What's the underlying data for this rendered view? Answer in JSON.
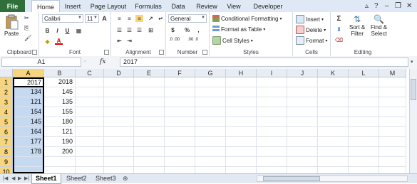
{
  "tabs": [
    "File",
    "Home",
    "Insert",
    "Page Layout",
    "Formulas",
    "Data",
    "Review",
    "View",
    "Developer"
  ],
  "ribbon": {
    "clipboard": {
      "paste": "Paste",
      "label": "Clipboard"
    },
    "font": {
      "name": "Calibri",
      "size": "11",
      "label": "Font",
      "bold": "B",
      "italic": "I",
      "underline": "U",
      "grow": "A",
      "shrink": "A",
      "fill_letter": "A"
    },
    "alignment": {
      "label": "Alignment"
    },
    "number": {
      "format": "General",
      "label": "Number",
      "currency": "$",
      "percent": "%",
      "comma": ",",
      "inc": ".0 .00",
      "dec": ".00 .0"
    },
    "styles": {
      "conditional": "Conditional Formatting",
      "format_table": "Format as Table",
      "cell_styles": "Cell Styles",
      "label": "Styles"
    },
    "cells": {
      "insert": "Insert",
      "delete": "Delete",
      "format": "Format",
      "label": "Cells"
    },
    "editing": {
      "sum": "Σ",
      "sort": "Sort &",
      "filter": "Filter",
      "find": "Find &",
      "select": "Select",
      "label": "Editing"
    }
  },
  "formula_bar": {
    "name_box": "A1",
    "fx": "fx",
    "value": "2017"
  },
  "columns": [
    "A",
    "B",
    "C",
    "D",
    "E",
    "F",
    "G",
    "H",
    "I",
    "J",
    "K",
    "L",
    "M"
  ],
  "rows": [
    "1",
    "2",
    "3",
    "4",
    "5",
    "6",
    "7",
    "8",
    "9",
    "10"
  ],
  "cells": {
    "A": [
      "2017",
      "134",
      "121",
      "154",
      "145",
      "164",
      "177",
      "178",
      "",
      ""
    ],
    "B": [
      "2018",
      "145",
      "135",
      "155",
      "180",
      "121",
      "190",
      "200",
      "",
      ""
    ]
  },
  "sheets": [
    "Sheet1",
    "Sheet2",
    "Sheet3"
  ],
  "colors": {
    "file_tab": "#2f6f39",
    "selection": "#c5d9f1",
    "header_sel": "#f6d57e"
  }
}
